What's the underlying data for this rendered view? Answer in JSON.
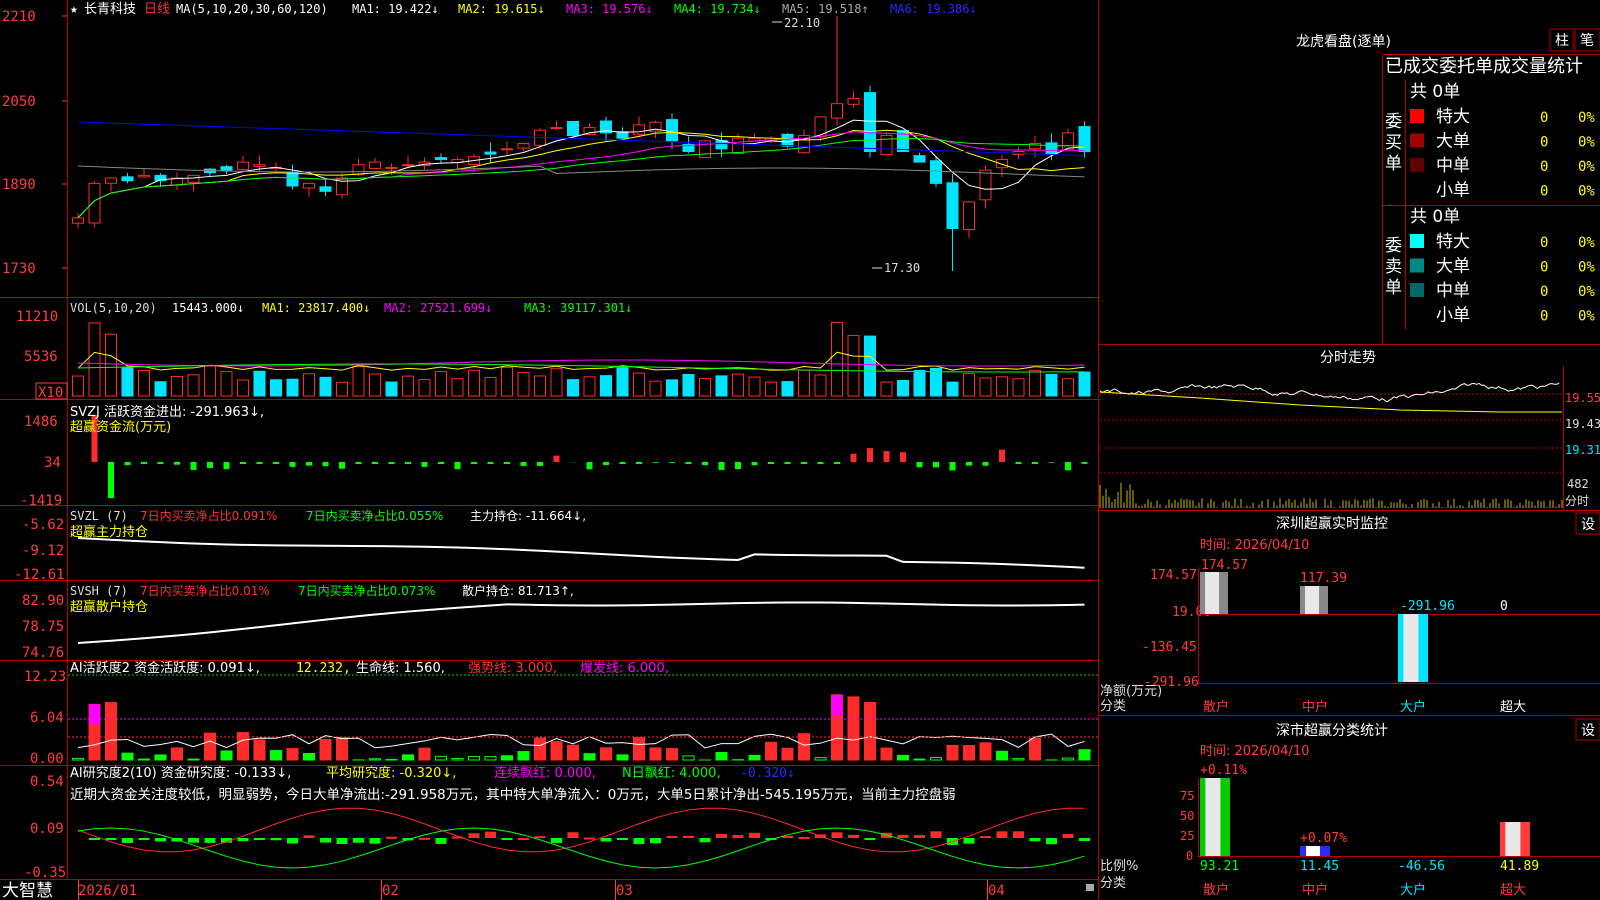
{
  "colors": {
    "up": "#ff2a2a",
    "down": "#00e5ff",
    "frame": "#b00000",
    "axis": "#ff3b3b",
    "bg": "#000000",
    "ma1": "#ffffff",
    "ma2": "#ffff00",
    "ma3": "#ff00ff",
    "ma4": "#00ff00",
    "ma6": "#0000ff",
    "green": "#00ff00",
    "yellow": "#ffff00",
    "magenta": "#ff00ff"
  },
  "header": {
    "star": "★",
    "stock_name": "长青科技",
    "period": "日线",
    "ma_params": "MA(5,10,20,30,60,120)",
    "ma1": "MA1: 19.422↓",
    "ma2": "MA2: 19.615↓",
    "ma3": "MA3: 19.576↓",
    "ma4": "MA4: 19.734↓",
    "ma5": "MA5: 19.518↑",
    "ma6": "MA6: 19.386↓",
    "high_label": "22.10",
    "low_label": "17.30"
  },
  "price_axis": [
    "2210",
    "2050",
    "1890",
    "1730"
  ],
  "vol": {
    "title": "VOL(5,10,20)",
    "value": "15443.000↓",
    "ma1": "MA1: 23817.400↓",
    "ma2": "MA2: 27521.699↓",
    "ma3": "MA3: 39117.301↓",
    "axis": [
      "11210",
      "5536",
      "X10"
    ]
  },
  "svzj": {
    "title": "SVZJ  活跃资金进出: -291.963↓,",
    "subtitle": "超赢资金流(万元)",
    "axis": [
      "1486",
      "34",
      "-1419"
    ]
  },
  "svzl": {
    "title": "SVZL (7)",
    "t1": "7日内买卖净占比0.091%",
    "t2": "7日内买卖净占比0.055%",
    "t3": "主力持仓: -11.664↓,",
    "subtitle": "超赢主力持仓",
    "axis": [
      "-5.62",
      "-9.12",
      "-12.61"
    ]
  },
  "svsh": {
    "title": "SVSH (7)",
    "t1": "7日内买卖净占比0.01%",
    "t2": "7日内买卖净占比0.073%",
    "t3": "散户持仓: 81.713↑,",
    "subtitle": "超赢散户持仓",
    "axis": [
      "82.90",
      "78.75",
      "74.76"
    ]
  },
  "ai1": {
    "title": "AI活跃度2 资金活跃度: 0.091↓,",
    "v1": "12.232,",
    "v2": "生命线: 1.560,",
    "v3": "强势线: 3.000,",
    "v4": "爆发线: 6.000,",
    "axis": [
      "12.23",
      "6.04",
      "0.00"
    ]
  },
  "ai2": {
    "title": "AI研究度2(10) 资金研究度: -0.133↓,",
    "v1": "平均研究度: -0.320↓,",
    "v2": "连续飘红: 0.000,",
    "v3": "N日飘红: 4.000,",
    "v4": "-0.320↓",
    "comment": "近期大资金关注度较低，明显弱势，今日大单净流出:-291.958万元，其中特大单净流入：0万元，大单5日累计净出-545.195万元，当前主力控盘弱",
    "axis": [
      "0.54",
      "0.09",
      "-0.35"
    ]
  },
  "xaxis": [
    "2026/01",
    "02",
    "03",
    "04"
  ],
  "brand": "大智慧",
  "right": {
    "title": "龙虎看盘(逐单)",
    "btn1": "柱",
    "btn2": "笔",
    "subtitle": "已成交委托单成交量统计",
    "buy_label": "委买单",
    "sell_label": "委卖单",
    "count": "共 0单",
    "buy_rows": [
      {
        "name": "特大",
        "val": "0",
        "pct": "0%",
        "color": "#ff0000"
      },
      {
        "name": "大单",
        "val": "0",
        "pct": "0%",
        "color": "#a00000"
      },
      {
        "name": "中单",
        "val": "0",
        "pct": "0%",
        "color": "#600000"
      },
      {
        "name": "小单",
        "val": "0",
        "pct": "0%",
        "color": ""
      }
    ],
    "sell_rows": [
      {
        "name": "特大",
        "val": "0",
        "pct": "0%",
        "color": "#00ffff"
      },
      {
        "name": "大单",
        "val": "0",
        "pct": "0%",
        "color": "#008888"
      },
      {
        "name": "中单",
        "val": "0",
        "pct": "0%",
        "color": "#006666"
      },
      {
        "name": "小单",
        "val": "0",
        "pct": "0%",
        "color": ""
      }
    ],
    "intraday_title": "分时走势",
    "intraday_axis": [
      "19.55",
      "19.43",
      "19.31",
      "482"
    ],
    "intraday_unit": "分时",
    "sz_title": "深圳超赢实时监控",
    "set": "设",
    "time": "时间: 2026/04/10",
    "sz_axis": [
      "174.57",
      "19.06",
      "-136.45",
      "-291.96"
    ],
    "sz_labels": [
      "174.57",
      "117.39",
      "-291.96",
      "0"
    ],
    "net_label": "净额(万元)",
    "cat_label": "分类",
    "cats": [
      "散户",
      "中户",
      "大户",
      "超大"
    ],
    "cls_title": "深市超赢分类统计",
    "cls_axis": [
      "75",
      "50",
      "25",
      "0"
    ],
    "cls_top": [
      "+0.11%",
      "+0.07%"
    ],
    "cls_bottom": [
      "93.21",
      "11.45",
      "-46.56",
      "41.89"
    ],
    "ratio_label": "比例%"
  }
}
